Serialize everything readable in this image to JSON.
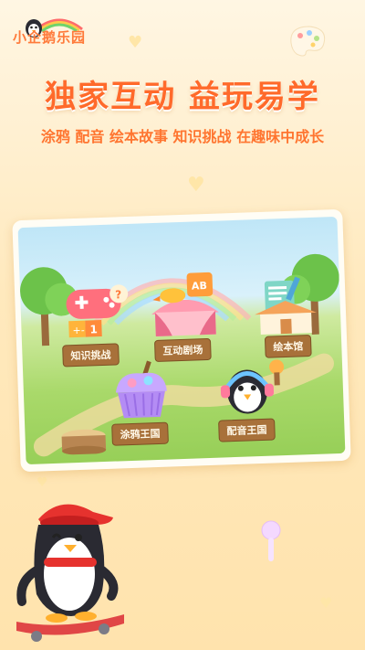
{
  "brand": {
    "logo_text": "小企鹅乐园"
  },
  "hero": {
    "headline": "独家互动 益玩易学",
    "subline": "涂鸦 配音 绘本故事 知识挑战 在趣味中成长"
  },
  "games": [
    {
      "label": "知识挑战"
    },
    {
      "label": "互动剧场"
    },
    {
      "label": "绘本馆"
    },
    {
      "label": "涂鸦王国"
    },
    {
      "label": "配音王国"
    }
  ],
  "colors": {
    "accent": "#ff6a2b",
    "background": "#ffe9bd",
    "label_wood": "#a8713a"
  },
  "icons": [
    "penguin-logo-icon",
    "gamepad-icon",
    "theater-icon",
    "book-icon",
    "cupcake-paint-icon",
    "headphones-penguin-icon",
    "microphone-icon",
    "palette-icon"
  ]
}
